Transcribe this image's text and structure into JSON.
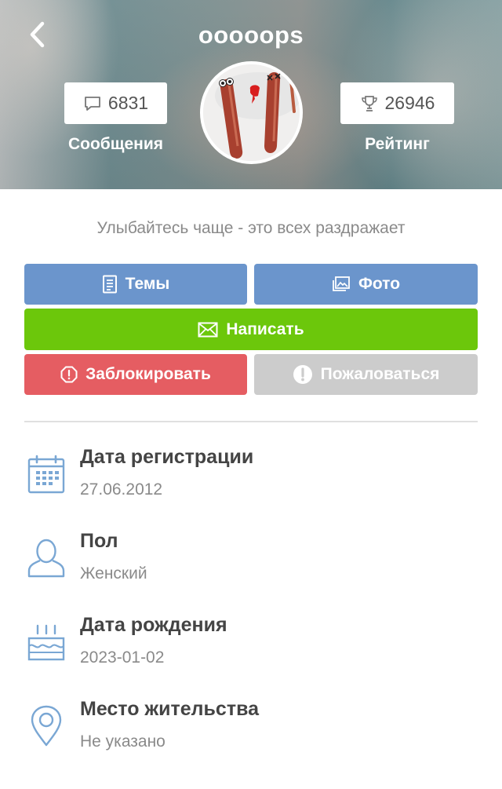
{
  "header": {
    "title": "ooooops",
    "back_icon": "chevron-left-icon"
  },
  "stats": {
    "messages": {
      "value": "6831",
      "label": "Сообщения",
      "icon": "speech-bubble-icon"
    },
    "rating": {
      "value": "26946",
      "label": "Рейтинг",
      "icon": "trophy-icon"
    }
  },
  "avatar": {
    "icon": "avatar-image"
  },
  "status_text": "Улыбайтесь чаще - это всех раздражает",
  "actions": {
    "topics": {
      "label": "Темы",
      "icon": "document-icon",
      "color": "#6b95cc"
    },
    "photo": {
      "label": "Фото",
      "icon": "photo-icon",
      "color": "#6b95cc"
    },
    "write": {
      "label": "Написать",
      "icon": "envelope-icon",
      "color": "#6cc70b"
    },
    "block": {
      "label": "Заблокировать",
      "icon": "stop-icon",
      "color": "#e55d62"
    },
    "report": {
      "label": "Пожаловаться",
      "icon": "exclamation-icon",
      "color": "#cccccc"
    }
  },
  "info": {
    "registration": {
      "label": "Дата регистрации",
      "value": "27.06.2012",
      "icon": "calendar-icon"
    },
    "gender": {
      "label": "Пол",
      "value": "Женский",
      "icon": "user-icon"
    },
    "birthday": {
      "label": "Дата рождения",
      "value": "2023-01-02",
      "icon": "cake-icon"
    },
    "residence": {
      "label": "Место жительства",
      "value": "Не указано",
      "icon": "location-pin-icon"
    }
  }
}
